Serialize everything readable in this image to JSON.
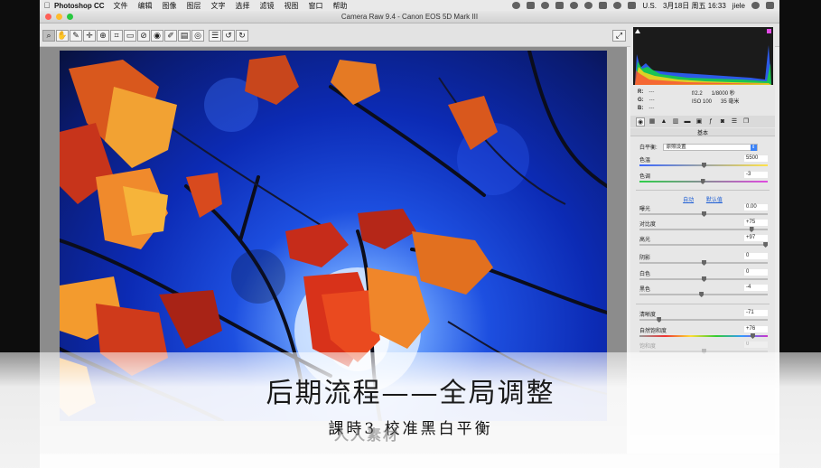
{
  "menubar": {
    "app_name": "Photoshop CC",
    "items": [
      "文件",
      "编辑",
      "图像",
      "图层",
      "文字",
      "选择",
      "滤镜",
      "视图",
      "窗口",
      "帮助"
    ],
    "input_source": "U.S.",
    "datetime": "3月18日 周五 16:33",
    "user": "jiele"
  },
  "window": {
    "title": "Camera Raw 9.4 -  Canon EOS 5D Mark III"
  },
  "toolbar": {
    "tools": [
      "zoom-tool",
      "hand-tool",
      "white-balance-tool",
      "color-sampler-tool",
      "targeted-adjustment-tool",
      "crop-tool",
      "straighten-tool",
      "spot-removal-tool",
      "red-eye-tool",
      "adjustment-brush-tool",
      "graduated-filter-tool",
      "radial-filter-tool",
      "preferences-tool",
      "rotate-left-tool",
      "rotate-right-tool"
    ],
    "tool_glyphs": [
      "⌕",
      "✋",
      "✎",
      "✛",
      "⊕",
      "⌗",
      "▭",
      "⊘",
      "◉",
      "✐",
      "▤",
      "◎",
      "☰",
      "↺",
      "↻"
    ]
  },
  "readout": {
    "r_label": "R:",
    "r_val": "---",
    "g_label": "G:",
    "g_val": "---",
    "b_label": "B:",
    "b_val": "---",
    "aperture": "f/2.2",
    "shutter": "1/8000 秒",
    "iso": "ISO 100",
    "focal": "35 毫米"
  },
  "panel": {
    "section_title": "基本",
    "wb_label": "白平衡:",
    "wb_value": "原照设置",
    "auto_label": "自动",
    "default_label": "默认值",
    "sliders_temp": [
      {
        "label": "色温",
        "value": "5500",
        "pos": 0.5
      },
      {
        "label": "色调",
        "value": "-3",
        "pos": 0.49
      }
    ],
    "sliders_tone": [
      {
        "label": "曝光",
        "value": "0.00",
        "pos": 0.5
      },
      {
        "label": "对比度",
        "value": "+75",
        "pos": 0.87
      },
      {
        "label": "高光",
        "value": "+97",
        "pos": 0.98
      },
      {
        "label": "阴影",
        "value": "0",
        "pos": 0.5
      },
      {
        "label": "白色",
        "value": "0",
        "pos": 0.5
      },
      {
        "label": "黑色",
        "value": "-4",
        "pos": 0.48
      }
    ],
    "sliders_presence": [
      {
        "label": "清晰度",
        "value": "-71",
        "pos": 0.15
      },
      {
        "label": "自然饱和度",
        "value": "+76",
        "pos": 0.88
      },
      {
        "label": "饱和度",
        "value": "0",
        "pos": 0.5
      }
    ]
  },
  "caption": {
    "title": "后期流程——全局调整",
    "subtitle": "課時3  校准黑白平衡",
    "watermark": "人人素材"
  },
  "colors": {
    "sky_deep": "#0a1a6e",
    "sky_mid": "#1d4fe0",
    "leaf_red": "#d8321a",
    "leaf_orange": "#f08a2c"
  }
}
